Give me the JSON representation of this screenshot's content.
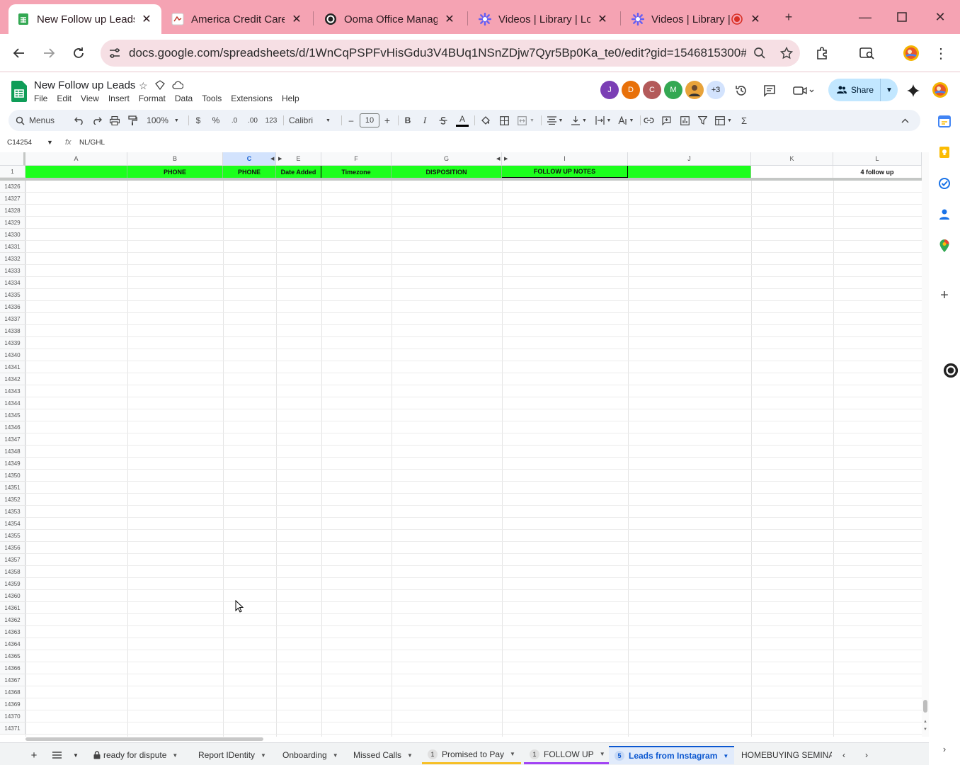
{
  "browser": {
    "tabs": [
      {
        "title": "New Follow up Leads",
        "active": true,
        "icon": "sheets-icon"
      },
      {
        "title": "America Credit Care",
        "active": false,
        "icon": "acc-logo-icon"
      },
      {
        "title": "Ooma Office Manage",
        "active": false,
        "icon": "ooma-icon"
      },
      {
        "title": "Videos | Library | Loo",
        "active": false,
        "icon": "loom-icon"
      },
      {
        "title": "Videos | Library |",
        "active": false,
        "icon": "loom-icon"
      }
    ],
    "new_tab_label": "+",
    "url": "docs.google.com/spreadsheets/d/1WnCqPSPFvHisGdu3V4BUq1NSnZDjw7Qyr5Bp0Ka_te0/edit?gid=1546815300#g..."
  },
  "doc": {
    "title": "New Follow up Leads",
    "menu": [
      "File",
      "Edit",
      "View",
      "Insert",
      "Format",
      "Data",
      "Tools",
      "Extensions",
      "Help"
    ],
    "collaborators": [
      {
        "initial": "J",
        "color": "#7b3fb5"
      },
      {
        "initial": "D",
        "color": "#e8710a"
      },
      {
        "initial": "C",
        "color": "#b35a5a"
      },
      {
        "initial": "M",
        "color": "#34a853"
      },
      {
        "initial": "",
        "color": "#6b4a2f"
      }
    ],
    "more_collaborators": "+3",
    "share_label": "Share"
  },
  "toolbar": {
    "menus_label": "Menus",
    "zoom": "100%",
    "currency": "$",
    "percent": "%",
    "dec_decrease": ".0",
    "dec_increase": ".00",
    "number_format": "123",
    "font": "Calibri",
    "font_size": "10",
    "bold": "B",
    "italic": "I",
    "text_color_letter": "A"
  },
  "formula_bar": {
    "cell_ref": "C14254",
    "fx": "fx",
    "content": "NL/GHL"
  },
  "grid": {
    "columns": [
      "A",
      "B",
      "C",
      "E",
      "F",
      "G",
      "I",
      "J",
      "K",
      "L"
    ],
    "selected_column": "C",
    "header_row_number": "1",
    "header_row": [
      "",
      "PHONE",
      "PHONE",
      "Date Added",
      "Timezone",
      "DISPOSITION",
      "FOLLOW UP NOTES",
      "",
      "",
      "4 follow up"
    ],
    "row_numbers": [
      "14326",
      "14327",
      "14328",
      "14329",
      "14330",
      "14331",
      "14332",
      "14333",
      "14334",
      "14335",
      "14336",
      "14337",
      "14338",
      "14339",
      "14340",
      "14341",
      "14342",
      "14343",
      "14344",
      "14345",
      "14346",
      "14347",
      "14348",
      "14349",
      "14350",
      "14351",
      "14352",
      "14353",
      "14354",
      "14355",
      "14356",
      "14357",
      "14358",
      "14359",
      "14360",
      "14361",
      "14362",
      "14363",
      "14364",
      "14365",
      "14366",
      "14367",
      "14368",
      "14369",
      "14370",
      "14371"
    ]
  },
  "sheet_tabs": [
    {
      "label": "ready for dispute",
      "locked": true,
      "badge": "",
      "active": false
    },
    {
      "label": "Report IDentity",
      "badge": "",
      "active": false
    },
    {
      "label": "Onboarding",
      "badge": "",
      "active": false
    },
    {
      "label": "Missed Calls",
      "badge": "",
      "active": false
    },
    {
      "label": "Promised to Pay",
      "badge": "1",
      "active": false
    },
    {
      "label": "FOLLOW UP",
      "badge": "1",
      "active": false
    },
    {
      "label": "Leads from Instagram",
      "badge": "5",
      "active": true
    },
    {
      "label": "HOMEBUYING SEMINAI",
      "badge": "",
      "active": false
    }
  ],
  "colors": {
    "tab_strip": "#f5a3b3",
    "header_green": "#1cff1c",
    "accent_blue": "#0b57d0"
  }
}
